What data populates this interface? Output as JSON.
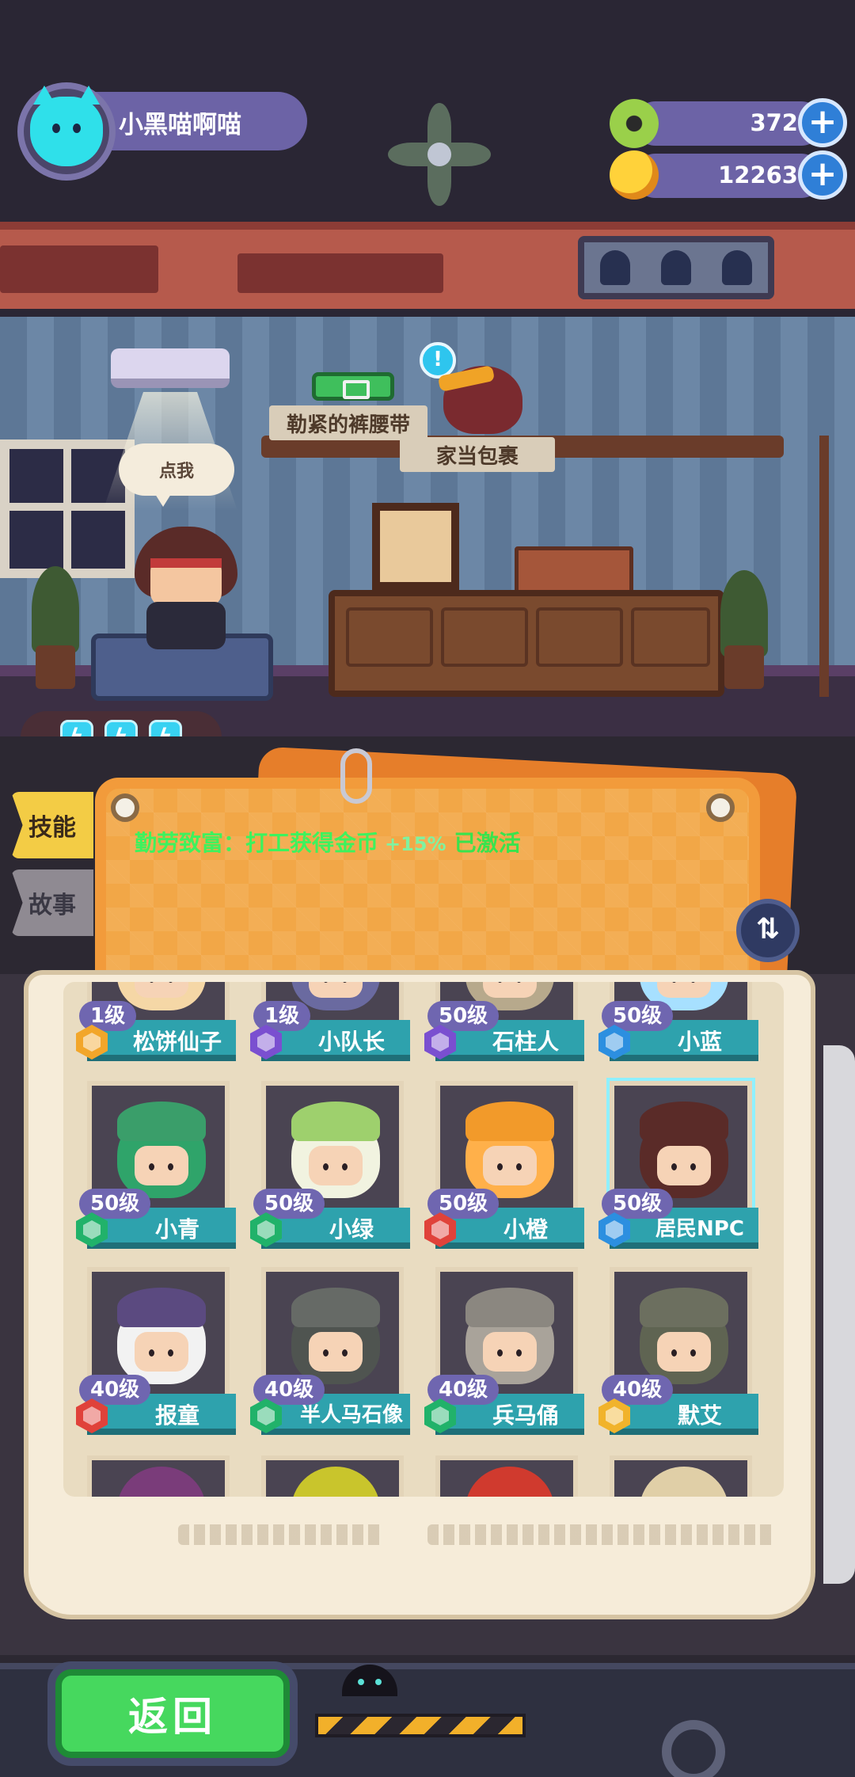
{
  "player": {
    "name": "小黑喵啊喵"
  },
  "currencies": [
    {
      "name": "coin",
      "icon": "donut-coin-icon",
      "value": "372"
    },
    {
      "name": "gem",
      "icon": "planet-gem-icon",
      "value": "12263"
    }
  ],
  "room": {
    "speech_bubble": "点我",
    "item_belt_label": "勒紧的裤腰带",
    "item_bag_label": "家当包裹",
    "alert": "!"
  },
  "energy": {
    "count": 3,
    "icon": "lightning-icon"
  },
  "tabs": [
    {
      "label": "技能",
      "active": true
    },
    {
      "label": "故事",
      "active": false
    }
  ],
  "skill": {
    "text": "勤劳致富：打工获得金币",
    "bonus": "+15%",
    "status": "已激活"
  },
  "characters": [
    {
      "level": "1级",
      "name": "松饼仙子",
      "badge": "orange"
    },
    {
      "level": "1级",
      "name": "小队长",
      "badge": "purple"
    },
    {
      "level": "50级",
      "name": "石柱人",
      "badge": "purple"
    },
    {
      "level": "50级",
      "name": "小蓝",
      "badge": "blue"
    },
    {
      "level": "50级",
      "name": "小青",
      "badge": "green"
    },
    {
      "level": "50级",
      "name": "小绿",
      "badge": "green"
    },
    {
      "level": "50级",
      "name": "小橙",
      "badge": "red"
    },
    {
      "level": "50级",
      "name": "居民NPC",
      "badge": "blue",
      "selected": true
    },
    {
      "level": "40级",
      "name": "报童",
      "badge": "red"
    },
    {
      "level": "40级",
      "name": "半人马石像",
      "badge": "green"
    },
    {
      "level": "40级",
      "name": "兵马俑",
      "badge": "green"
    },
    {
      "level": "40级",
      "name": "默艾",
      "badge": "gold"
    }
  ],
  "footer": {
    "back_label": "返回"
  },
  "colors": {
    "accent_purple": "#6c63a6",
    "skill_green": "#3df25d",
    "name_bar_teal": "#2ea2ad",
    "back_green": "#46d85e",
    "board_orange": "#f2a747"
  }
}
